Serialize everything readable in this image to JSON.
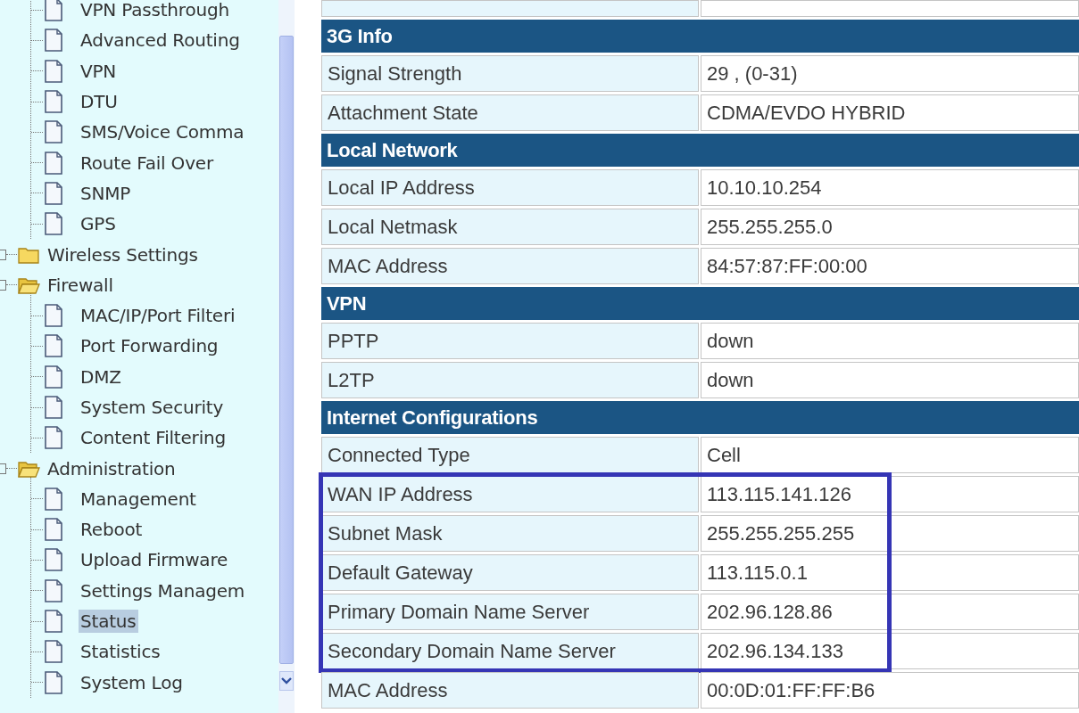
{
  "sidebar": {
    "tree": [
      {
        "children": [
          {
            "label": "VPN Passthrough",
            "selected": false
          },
          {
            "label": "Advanced Routing",
            "selected": false
          },
          {
            "label": "VPN",
            "selected": false
          },
          {
            "label": "DTU",
            "selected": false
          },
          {
            "label": "SMS/Voice Comma",
            "selected": false
          },
          {
            "label": "Route Fail Over",
            "selected": false
          },
          {
            "label": "SNMP",
            "selected": false
          },
          {
            "label": "GPS",
            "selected": false
          }
        ]
      },
      {
        "label": "Wireless Settings",
        "expanded": false
      },
      {
        "label": "Firewall",
        "expanded": true,
        "children": [
          {
            "label": "MAC/IP/Port Filteri",
            "selected": false
          },
          {
            "label": "Port Forwarding",
            "selected": false
          },
          {
            "label": "DMZ",
            "selected": false
          },
          {
            "label": "System Security",
            "selected": false
          },
          {
            "label": "Content Filtering",
            "selected": false
          }
        ]
      },
      {
        "label": "Administration",
        "expanded": true,
        "children": [
          {
            "label": "Management",
            "selected": false
          },
          {
            "label": "Reboot",
            "selected": false
          },
          {
            "label": "Upload Firmware",
            "selected": false
          },
          {
            "label": "Settings Managem",
            "selected": false
          },
          {
            "label": "Status",
            "selected": true
          },
          {
            "label": "Statistics",
            "selected": false
          },
          {
            "label": "System Log",
            "selected": false
          }
        ]
      }
    ]
  },
  "sections": [
    {
      "title": "3G Info",
      "rows": [
        {
          "label": "Signal Strength",
          "value": "29 , (0-31)",
          "highlighted": false
        },
        {
          "label": "Attachment State",
          "value": "CDMA/EVDO HYBRID",
          "highlighted": false
        }
      ]
    },
    {
      "title": "Local Network",
      "rows": [
        {
          "label": "Local IP Address",
          "value": "10.10.10.254",
          "highlighted": false
        },
        {
          "label": "Local Netmask",
          "value": "255.255.255.0",
          "highlighted": false
        },
        {
          "label": "MAC Address",
          "value": "84:57:87:FF:00:00",
          "highlighted": false
        }
      ]
    },
    {
      "title": "VPN",
      "rows": [
        {
          "label": "PPTP",
          "value": "down",
          "highlighted": false
        },
        {
          "label": "L2TP",
          "value": "down",
          "highlighted": false
        }
      ]
    },
    {
      "title": "Internet Configurations",
      "rows": [
        {
          "label": "Connected Type",
          "value": "Cell",
          "highlighted": false
        },
        {
          "label": "WAN IP Address",
          "value": "113.115.141.126",
          "highlighted": true
        },
        {
          "label": "Subnet Mask",
          "value": "255.255.255.255",
          "highlighted": true
        },
        {
          "label": "Default Gateway",
          "value": "113.115.0.1",
          "highlighted": true
        },
        {
          "label": "Primary Domain Name Server",
          "value": "202.96.128.86",
          "highlighted": true
        },
        {
          "label": "Secondary Domain Name Server",
          "value": "202.96.134.133",
          "highlighted": true
        },
        {
          "label": "MAC Address",
          "value": "00:0D:01:FF:FF:B6",
          "highlighted": false
        }
      ]
    }
  ]
}
